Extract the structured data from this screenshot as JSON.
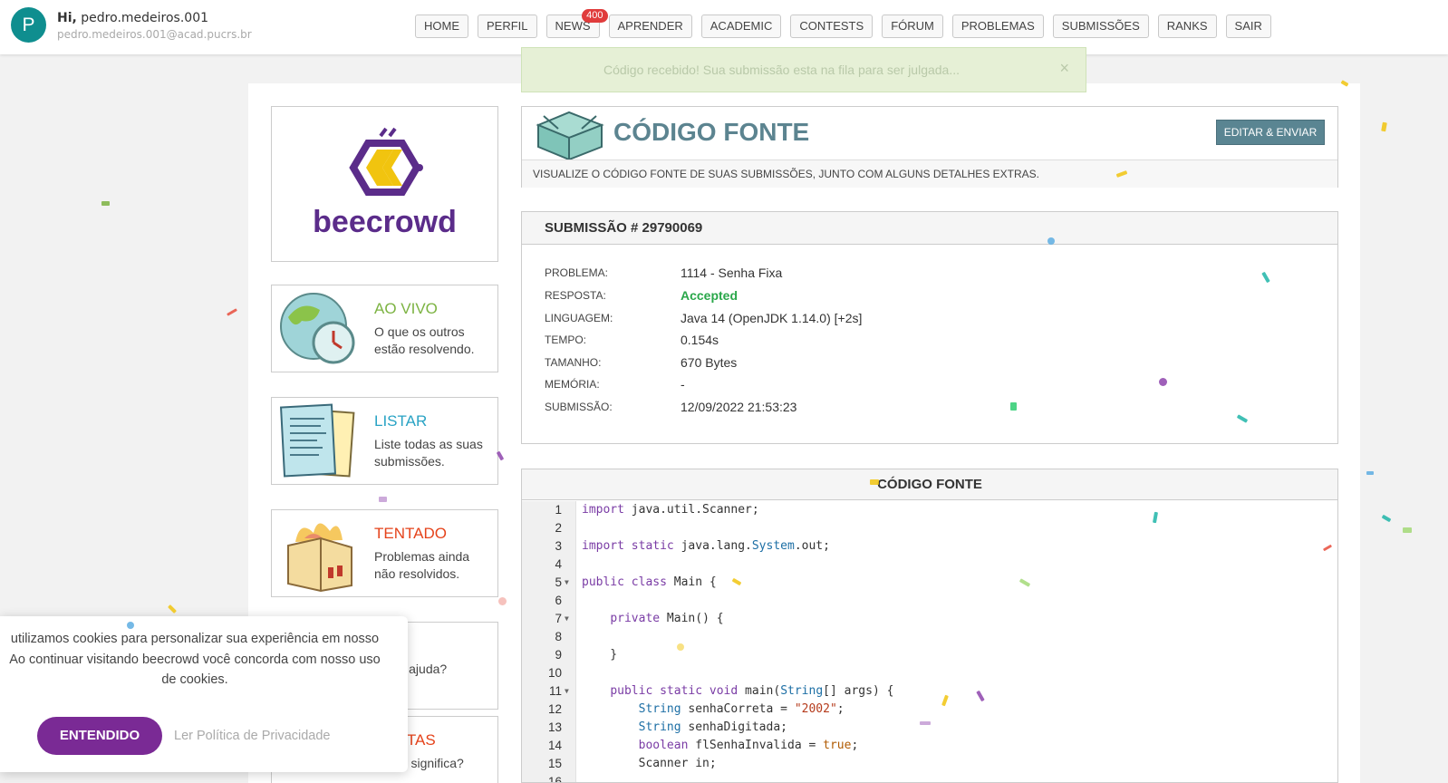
{
  "user": {
    "avatar_letter": "P",
    "greeting_prefix": "Hi,",
    "username": "pedro.medeiros.001",
    "email": "pedro.medeiros.001@acad.pucrs.br"
  },
  "nav": {
    "items": [
      {
        "label": "HOME"
      },
      {
        "label": "PERFIL"
      },
      {
        "label": "NEWS",
        "badge": "400"
      },
      {
        "label": "APRENDER"
      },
      {
        "label": "ACADEMIC"
      },
      {
        "label": "CONTESTS"
      },
      {
        "label": "FÓRUM"
      },
      {
        "label": "PROBLEMAS"
      },
      {
        "label": "SUBMISSÕES"
      },
      {
        "label": "RANKS"
      },
      {
        "label": "SAIR"
      }
    ]
  },
  "toast": {
    "message": "Código recebido! Sua submissão esta na fila para ser julgada...",
    "close_icon": "×"
  },
  "logo": {
    "text": "beecrowd"
  },
  "side": [
    {
      "title": "AO VIVO",
      "desc": "O que os outros estão resolvendo.",
      "color": "#7cb342",
      "icon": "globe-clock-icon"
    },
    {
      "title": "LISTAR",
      "desc": "Liste todas as suas submissões.",
      "color": "#29a3c4",
      "icon": "papers-icon"
    },
    {
      "title": "TENTADO",
      "desc": "Problemas ainda não resolvidos.",
      "color": "#e5431b",
      "icon": "burning-box-icon"
    },
    {
      "title": "S",
      "desc": "sa de ajuda?",
      "color": "#b23b6e",
      "icon": "help-icon"
    },
    {
      "title": "POSTAS",
      "desc": "e isso significa?",
      "color": "#e5431b",
      "icon": "answers-icon"
    }
  ],
  "source": {
    "title": "CÓDIGO FONTE",
    "button": "EDITAR & ENVIAR",
    "subtitle": "VISUALIZE O CÓDIGO FONTE DE SUAS SUBMISSÕES, JUNTO COM ALGUNS DETALHES EXTRAS."
  },
  "submission": {
    "title": "SUBMISSÃO # 29790069",
    "rows": [
      {
        "label": "PROBLEMA:",
        "value": "1114 - Senha Fixa"
      },
      {
        "label": "RESPOSTA:",
        "value": "Accepted"
      },
      {
        "label": "LINGUAGEM:",
        "value": "Java 14 (OpenJDK 1.14.0) [+2s]"
      },
      {
        "label": "TEMPO:",
        "value": "0.154s"
      },
      {
        "label": "TAMANHO:",
        "value": "670 Bytes"
      },
      {
        "label": "MEMÓRIA:",
        "value": "-"
      },
      {
        "label": "SUBMISSÃO:",
        "value": "12/09/2022 21:53:23"
      }
    ]
  },
  "code": {
    "title": "CÓDIGO FONTE",
    "lines": [
      {
        "n": "1",
        "html": "<span class=\"kw\">import</span> java.util.Scanner;"
      },
      {
        "n": "2",
        "html": ""
      },
      {
        "n": "3",
        "html": "<span class=\"kw\">import</span> <span class=\"kw\">static</span> java.lang.<span class=\"ty\">System</span>.out;"
      },
      {
        "n": "4",
        "html": ""
      },
      {
        "n": "5",
        "fold": true,
        "html": "<span class=\"kw\">public</span> <span class=\"kw\">class</span> Main {"
      },
      {
        "n": "6",
        "html": ""
      },
      {
        "n": "7",
        "fold": true,
        "html": "    <span class=\"kw\">private</span> Main() {"
      },
      {
        "n": "8",
        "html": ""
      },
      {
        "n": "9",
        "html": "    }"
      },
      {
        "n": "10",
        "html": ""
      },
      {
        "n": "11",
        "fold": true,
        "html": "    <span class=\"kw\">public</span> <span class=\"kw\">static</span> <span class=\"kw\">void</span> main(<span class=\"ty\">String</span>[] args) {"
      },
      {
        "n": "12",
        "html": "        <span class=\"ty\">String</span> senhaCorreta = <span class=\"str\">\"2002\"</span>;"
      },
      {
        "n": "13",
        "html": "        <span class=\"ty\">String</span> senhaDigitada;"
      },
      {
        "n": "14",
        "html": "        <span class=\"kw\">boolean</span> flSenhaInvalida = <span class=\"bool\">true</span>;"
      },
      {
        "n": "15",
        "html": "        Scanner in;"
      },
      {
        "n": "16",
        "html": ""
      }
    ]
  },
  "cookie": {
    "line1": "utilizamos cookies para personalizar sua experiência em nosso",
    "line2": "Ao continuar visitando beecrowd você concorda com nosso uso",
    "line3": "de cookies.",
    "button": "ENTENDIDO",
    "link": "Ler Política de Privacidade"
  },
  "colors": {
    "brand_purple": "#5b2c8a",
    "accent_teal": "#5c8490",
    "accepted_green": "#2aa74a",
    "badge_red": "#e03c3c"
  }
}
